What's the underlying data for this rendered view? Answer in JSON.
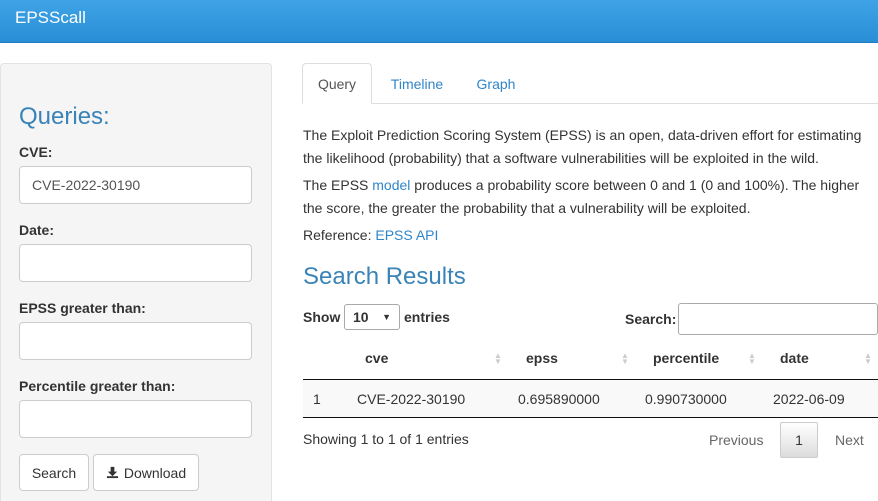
{
  "app": {
    "title": "EPSScall"
  },
  "sidebar": {
    "title": "Queries:",
    "fields": [
      {
        "label": "CVE:",
        "value": "CVE-2022-30190",
        "placeholder": ""
      },
      {
        "label": "Date:",
        "value": "",
        "placeholder": ""
      },
      {
        "label": "EPSS greater than:",
        "value": "",
        "placeholder": ""
      },
      {
        "label": "Percentile greater than:",
        "value": "",
        "placeholder": ""
      }
    ],
    "search_button": "Search",
    "download_button": "Download"
  },
  "tabs": [
    {
      "label": "Query",
      "active": true
    },
    {
      "label": "Timeline",
      "active": false
    },
    {
      "label": "Graph",
      "active": false
    }
  ],
  "intro": {
    "p1": "The Exploit Prediction Scoring System (EPSS) is an open, data-driven effort for estimating the likelihood (probability) that a software vulnerabilities will be exploited in the wild.",
    "p2_before": "The EPSS ",
    "p2_link": "model",
    "p2_after": " produces a probability score between 0 and 1 (0 and 100%). The higher the score, the greater the probability that a vulnerability will be exploited.",
    "ref_label": "Reference: ",
    "ref_link": "EPSS API"
  },
  "results": {
    "title": "Search Results",
    "show_label": "Show",
    "entries_label": "entries",
    "page_size": "10",
    "search_label": "Search:",
    "search_value": "",
    "columns": [
      "",
      "cve",
      "epss",
      "percentile",
      "date"
    ],
    "rows": [
      [
        "1",
        "CVE-2022-30190",
        "0.695890000",
        "0.990730000",
        "2022-06-09"
      ]
    ],
    "info": "Showing 1 to 1 of 1 entries",
    "pagination": {
      "previous": "Previous",
      "current": "1",
      "next": "Next"
    }
  },
  "colors": {
    "navbar": "#2a8ed6",
    "link": "#2f86c9",
    "heading": "#3a83b6"
  }
}
